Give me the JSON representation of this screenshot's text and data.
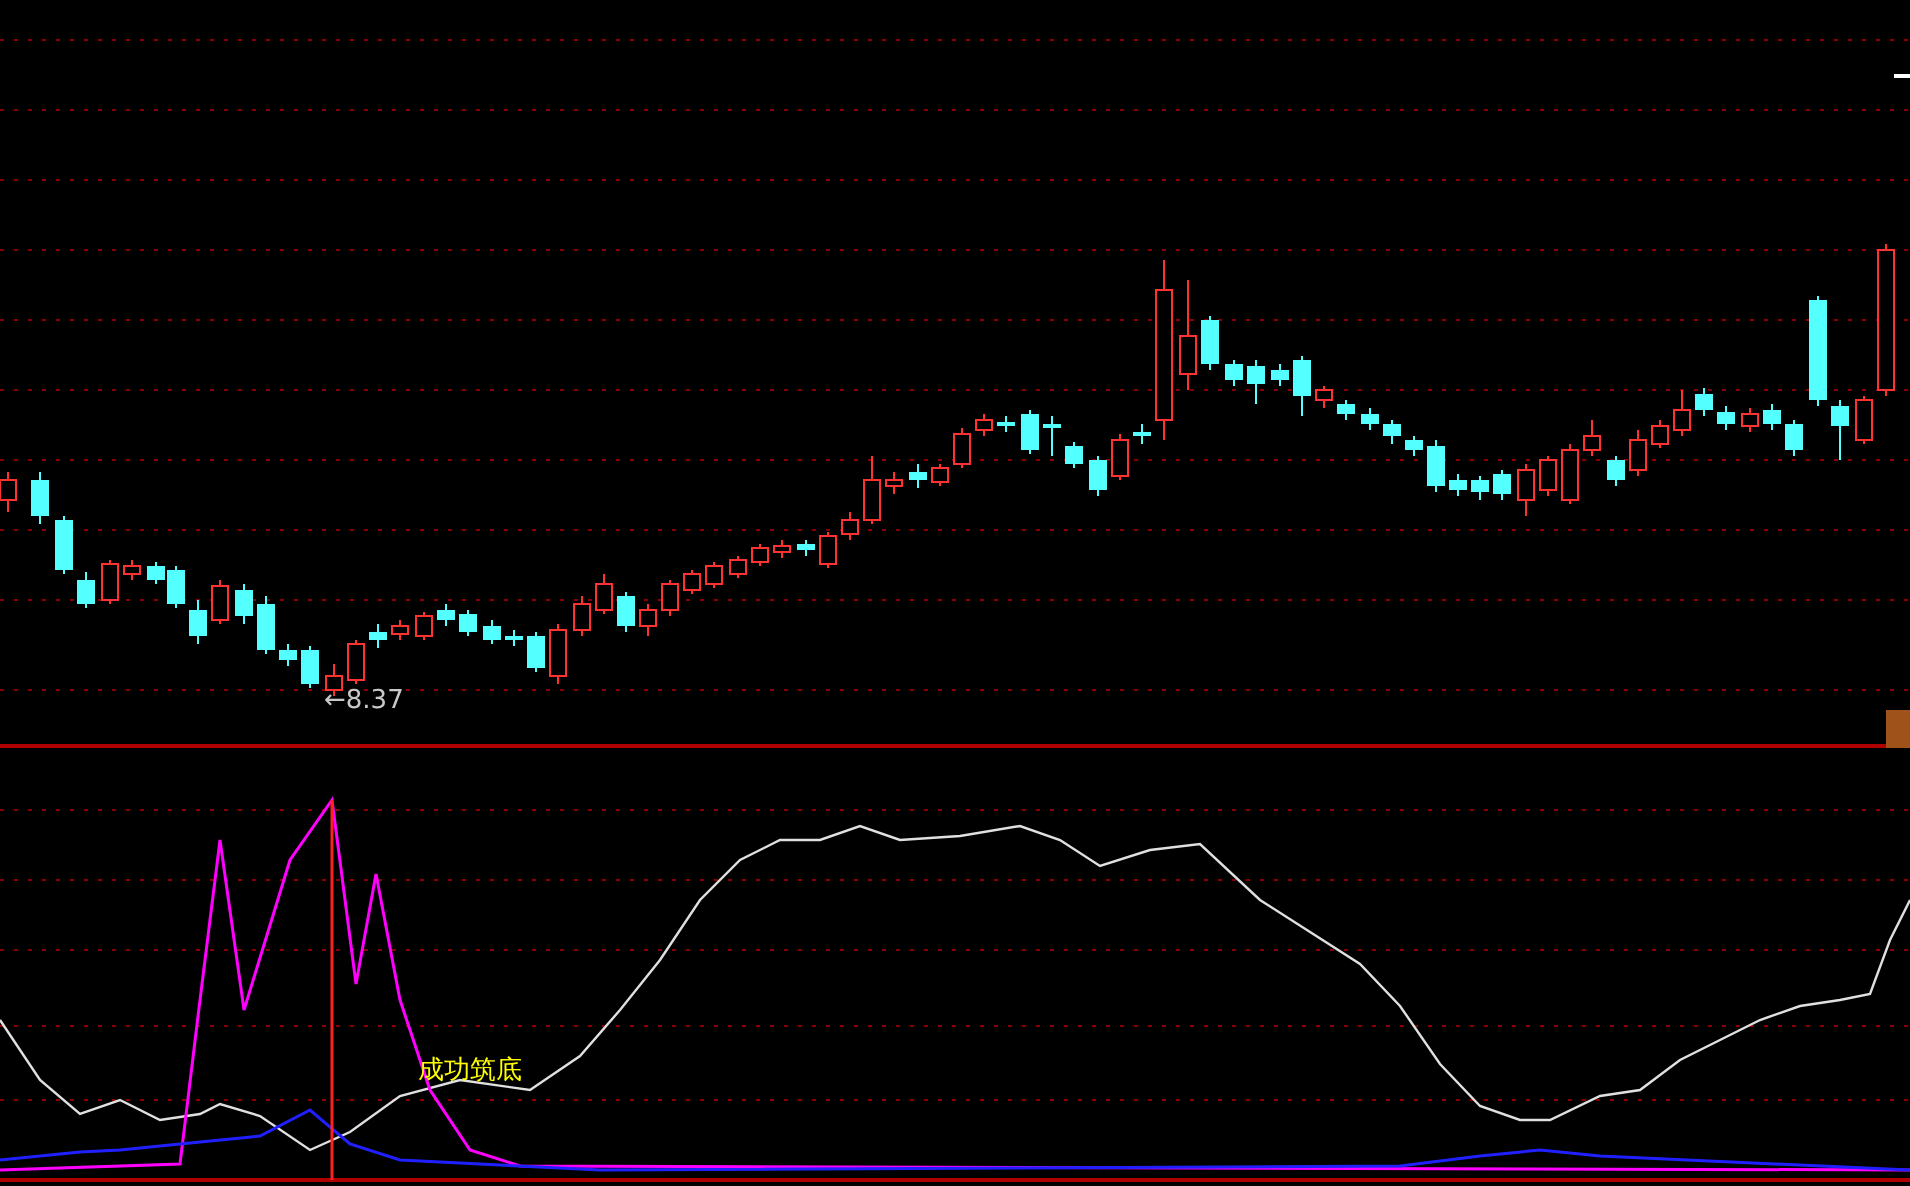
{
  "price_panel": {
    "low_marker": "←8.37"
  },
  "indicator_panel": {
    "signal_label": "成功筑底"
  }
}
